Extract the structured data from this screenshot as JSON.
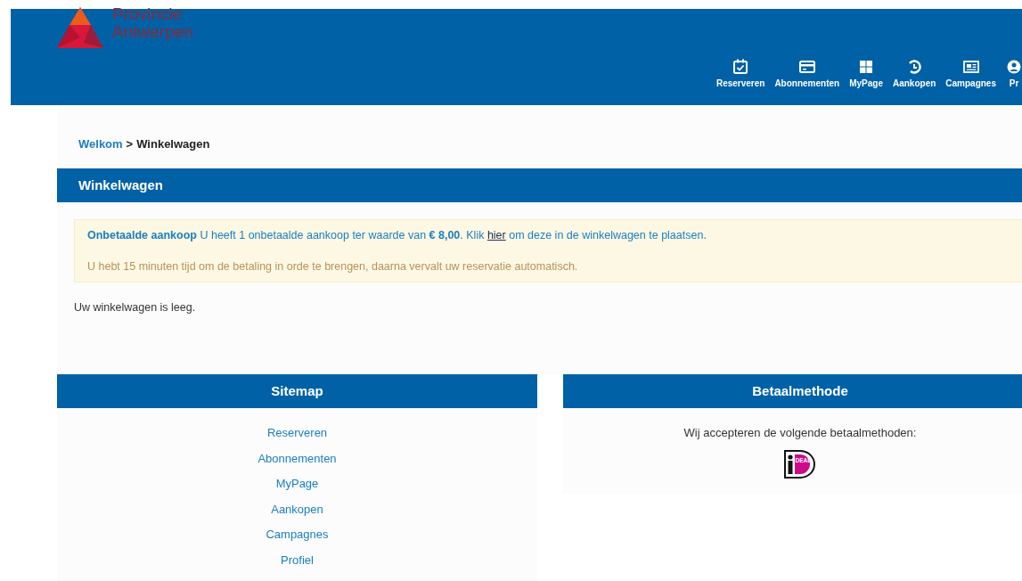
{
  "header": {
    "logo_lines": [
      "Provincie",
      "Antwerpen"
    ],
    "nav": [
      {
        "kind": "calendar",
        "label": "Reserveren"
      },
      {
        "kind": "card",
        "label": "Abonnementen"
      },
      {
        "kind": "grid",
        "label": "MyPage"
      },
      {
        "kind": "history",
        "label": "Aankopen"
      },
      {
        "kind": "newspaper",
        "label": "Campagnes"
      },
      {
        "kind": "user",
        "label": "Pr"
      }
    ]
  },
  "breadcrumb": {
    "link": "Welkom",
    "separator": ">",
    "current": "Winkelwagen"
  },
  "cart": {
    "title": "Winkelwagen",
    "alert": {
      "message": "**Onbetaalde aankoop** U heeft 1 onbetaalde aankoop ter waarde van **€ 8,00**. Klik",
      "link": "hier",
      "message_end": "om deze in de winkelwagen te plaatsen.",
      "note": "U hebt 15 minuten tijd om de betaling in orde te brengen, daarna vervalt uw reservatie automatisch."
    },
    "empty_text": "Uw winkelwagen is leeg."
  },
  "sitemap": {
    "title": "Sitemap",
    "links": [
      "Reserveren",
      "Abonnementen",
      "MyPage",
      "Aankopen",
      "Campagnes",
      "Profiel"
    ]
  },
  "payment": {
    "title": "Betaalmethode",
    "text": "Wij accepteren de volgende betaalmethoden:",
    "logo_text": "DEAL"
  }
}
